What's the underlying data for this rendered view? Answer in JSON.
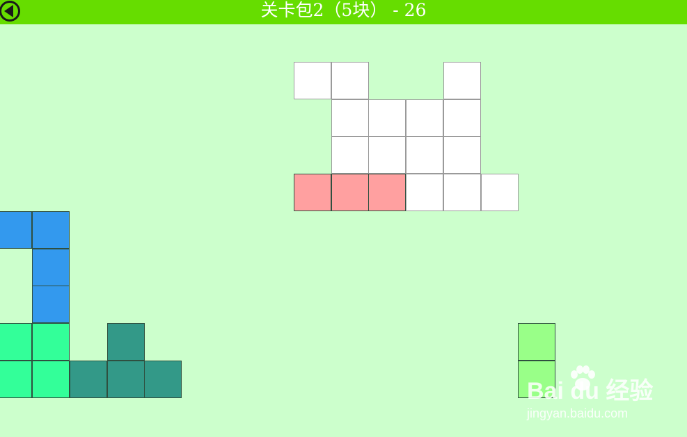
{
  "header": {
    "title": "关卡包2（5块） - 26",
    "back_icon": "back-arrow-icon"
  },
  "colors": {
    "background": "#ccffcc",
    "header": "#66dd00",
    "target": "#ffffff",
    "pink": "#ffa0a0",
    "blue": "#3399ee",
    "green": "#33ff99",
    "teal": "#339988",
    "lightgreen": "#99ff88"
  },
  "board": {
    "target_cells": [
      [
        0,
        0
      ],
      [
        1,
        0
      ],
      [
        4,
        0
      ],
      [
        1,
        1
      ],
      [
        2,
        1
      ],
      [
        3,
        1
      ],
      [
        4,
        1
      ],
      [
        1,
        2
      ],
      [
        2,
        2
      ],
      [
        3,
        2
      ],
      [
        4,
        2
      ],
      [
        3,
        3
      ],
      [
        4,
        3
      ],
      [
        5,
        3
      ]
    ],
    "pieces": [
      {
        "name": "pink-piece",
        "color": "#ffa0a0",
        "cells": [
          [
            0,
            3
          ],
          [
            1,
            3
          ],
          [
            2,
            3
          ]
        ]
      },
      {
        "name": "blue-piece",
        "color": "#3399ee",
        "cells": [
          [
            -8,
            4
          ],
          [
            -7,
            4
          ],
          [
            -7,
            5
          ],
          [
            -7,
            6
          ]
        ]
      },
      {
        "name": "green-piece",
        "color": "#33ff99",
        "cells": [
          [
            -8,
            7
          ],
          [
            -7,
            7
          ],
          [
            -8,
            8
          ],
          [
            -7,
            8
          ]
        ]
      },
      {
        "name": "teal-piece",
        "color": "#339988",
        "cells": [
          [
            -5,
            7
          ],
          [
            -6,
            8
          ],
          [
            -5,
            8
          ],
          [
            -4,
            8
          ]
        ]
      },
      {
        "name": "lightgreen-piece",
        "color": "#99ff88",
        "cells": [
          [
            6,
            7
          ],
          [
            6,
            8
          ]
        ]
      }
    ]
  },
  "watermark": {
    "logo": "Bai  du 经验",
    "url": "jingyan.baidu.com"
  }
}
